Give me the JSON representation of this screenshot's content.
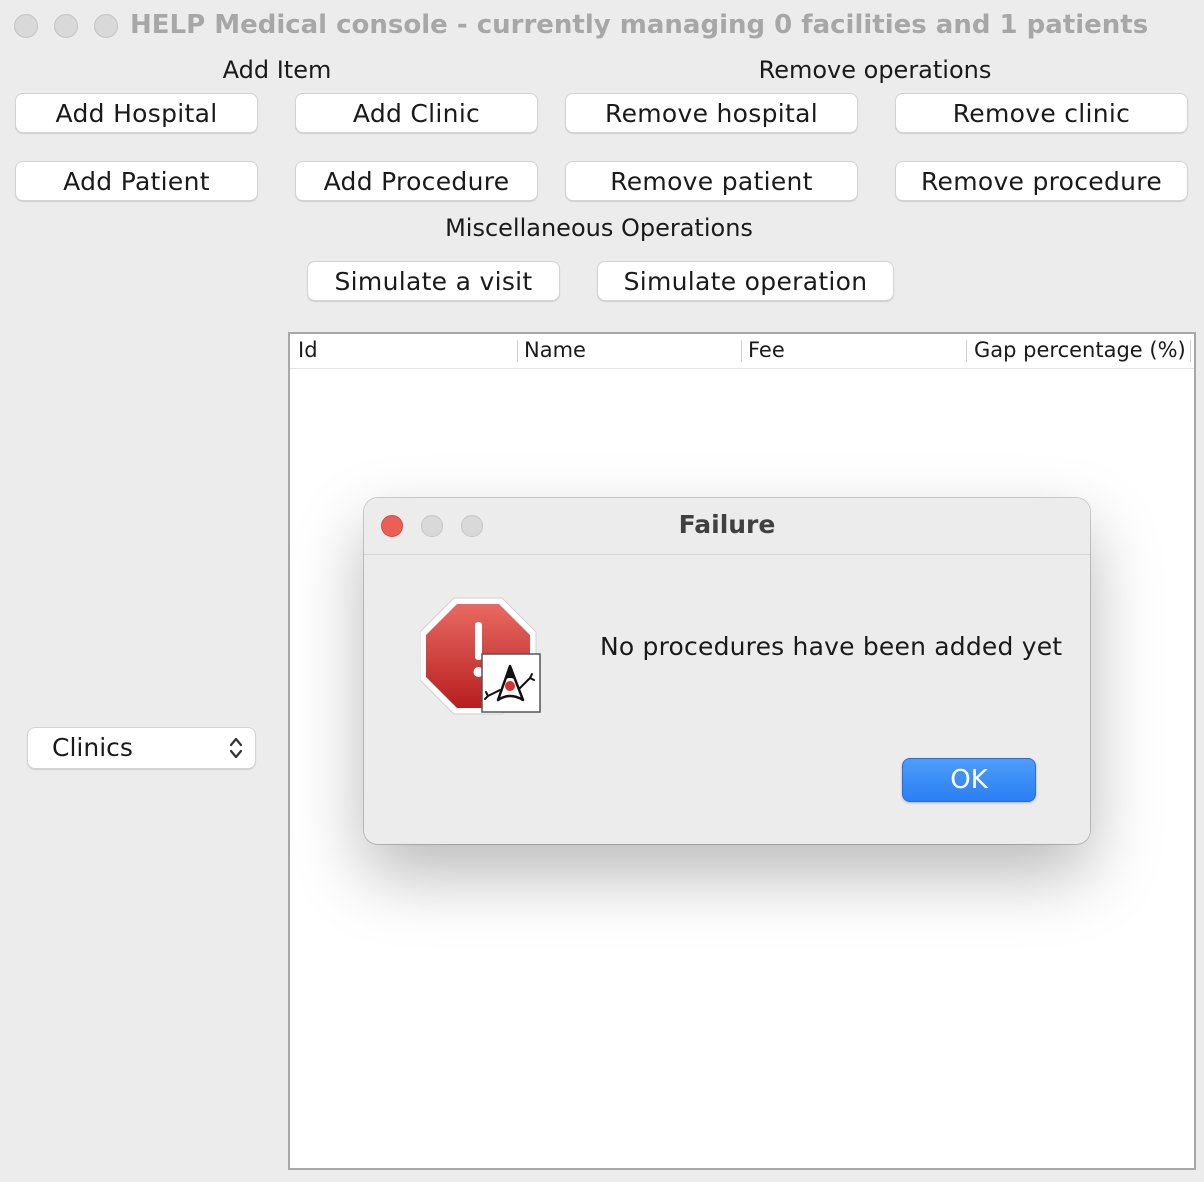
{
  "window": {
    "title": "HELP Medical console - currently managing 0 facilities and 1 patients"
  },
  "sections": {
    "add_item": "Add Item",
    "remove_operations": "Remove operations",
    "misc_operations": "Miscellaneous Operations"
  },
  "buttons": {
    "add_hospital": "Add Hospital",
    "add_clinic": "Add Clinic",
    "remove_hospital": "Remove hospital",
    "remove_clinic": "Remove clinic",
    "add_patient": "Add Patient",
    "add_procedure": "Add Procedure",
    "remove_patient": "Remove patient",
    "remove_procedure": "Remove procedure",
    "simulate_visit": "Simulate a visit",
    "simulate_operation": "Simulate operation"
  },
  "facility_selector": {
    "selected": "Clinics"
  },
  "table": {
    "columns": [
      "Id",
      "Name",
      "Fee",
      "Gap percentage (%)"
    ],
    "rows": []
  },
  "dialog": {
    "title": "Failure",
    "message": "No procedures have been added yet",
    "ok_label": "OK",
    "icon": "error-stop-sign-icon"
  },
  "colors": {
    "window_bg": "#ececec",
    "accent_blue": "#2a7ff3",
    "error_red": "#d63a3a",
    "close_red": "#ec5f57"
  }
}
